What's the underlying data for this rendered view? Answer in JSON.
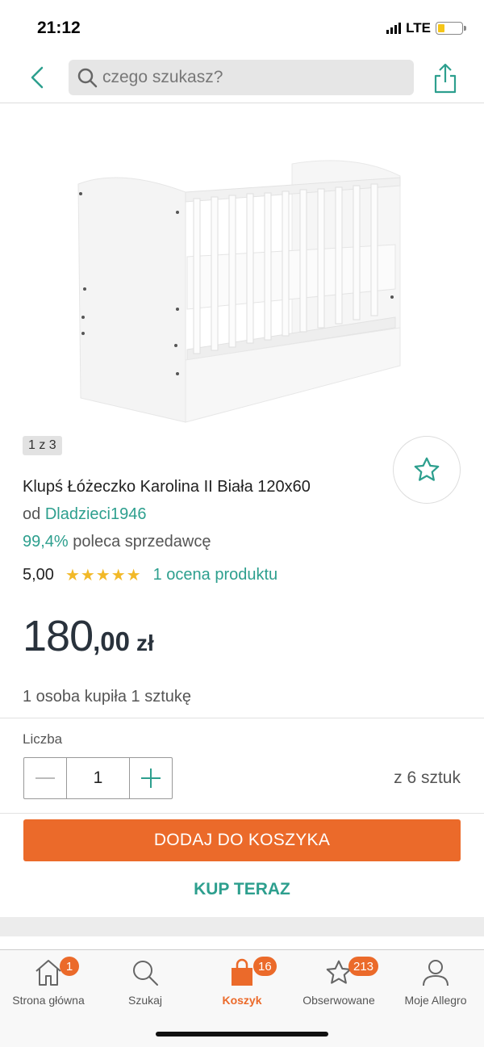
{
  "status_bar": {
    "time": "21:12",
    "network": "LTE"
  },
  "search": {
    "placeholder": "czego szukasz?"
  },
  "gallery": {
    "counter": "1 z 3"
  },
  "product": {
    "title": "Klupś Łóżeczko Karolina II Biała 120x60",
    "seller_prefix": "od",
    "seller_name": "Dladzieci1946",
    "recommend_pct": "99,4%",
    "recommend_text": "poleca sprzedawcę",
    "rating_score": "5,00",
    "rating_stars": 5,
    "rating_count_text": "1 ocena produktu",
    "price_int": "180",
    "price_dec": ",00",
    "currency": "zł",
    "bought_text": "1 osoba kupiła 1 sztukę"
  },
  "quantity": {
    "label": "Liczba",
    "value": "1",
    "stock_text": "z 6 sztuk"
  },
  "actions": {
    "add_to_cart": "DODAJ DO KOSZYKA",
    "buy_now": "KUP TERAZ"
  },
  "bottom_nav": {
    "items": [
      {
        "label": "Strona główna",
        "icon": "home-icon",
        "badge": "1"
      },
      {
        "label": "Szukaj",
        "icon": "search-icon",
        "badge": ""
      },
      {
        "label": "Koszyk",
        "icon": "cart-bag-icon",
        "badge": "16",
        "active": true
      },
      {
        "label": "Obserwowane",
        "icon": "star-icon",
        "badge": "213"
      },
      {
        "label": "Moje Allegro",
        "icon": "user-icon",
        "badge": ""
      }
    ]
  },
  "colors": {
    "accent_teal": "#2d9f8e",
    "accent_orange": "#eb6a2a",
    "star_yellow": "#f2b928",
    "price_dark": "#29323c"
  }
}
